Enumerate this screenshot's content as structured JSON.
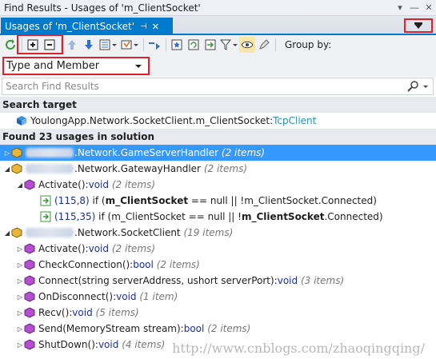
{
  "window": {
    "title": "Find Results - Usages of 'm_ClientSocket'"
  },
  "tab": {
    "label": "Usages of 'm_ClientSocket'"
  },
  "toolbar": {
    "group_by_label": "Group by:"
  },
  "dropdown": {
    "selected": "Type and Member"
  },
  "search": {
    "placeholder": "Search Find Results"
  },
  "search_target": {
    "header": "Search target",
    "item": {
      "ns": "YoulongApp.Network.SocketClient.m_ClientSocket:",
      "type": "TcpClient"
    }
  },
  "found": {
    "header": "Found 23 usages in solution",
    "rows": [
      {
        "label": ".Network.GameServerHandler",
        "count": "(2 items)"
      },
      {
        "label": ".Network.GatewayHandler",
        "count": "(2 items)"
      },
      {
        "method": "Activate():",
        "ret": "void",
        "count": "(2 items)"
      },
      {
        "pos": "(115,8)",
        "pre": " if (",
        "bold": "m_ClientSocket",
        "post": " == null || !m_ClientSocket.Connected)"
      },
      {
        "pos": "(115,35)",
        "pre": " if (m_ClientSocket == null || !",
        "bold": "m_ClientSocket",
        "post": ".Connected)"
      },
      {
        "label": ".Network.SocketClient",
        "count": "(19 items)"
      },
      {
        "method": "Activate():",
        "ret": "void",
        "count": "(2 items)"
      },
      {
        "method": "CheckConnection():",
        "ret": "bool",
        "count": "(2 items)"
      },
      {
        "method": "Connect(string serverAddress, ushort serverPort):",
        "ret": "void",
        "count": "(3 items)"
      },
      {
        "method": "OnDisconnect():",
        "ret": "void",
        "count": "(1 item)"
      },
      {
        "method": "Recv():",
        "ret": "void",
        "count": "(5 items)"
      },
      {
        "method": "Send(MemoryStream stream):",
        "ret": "bool",
        "count": "(2 items)"
      },
      {
        "method": "ShutDown():",
        "ret": "void",
        "count": "(4 items)"
      }
    ]
  },
  "watermark": "http://www.cnblogs.com/zhaoqingqing/",
  "colors": {
    "accent": "#007acc",
    "highlight": "#e0202a",
    "selected_row": "#3399ff"
  }
}
